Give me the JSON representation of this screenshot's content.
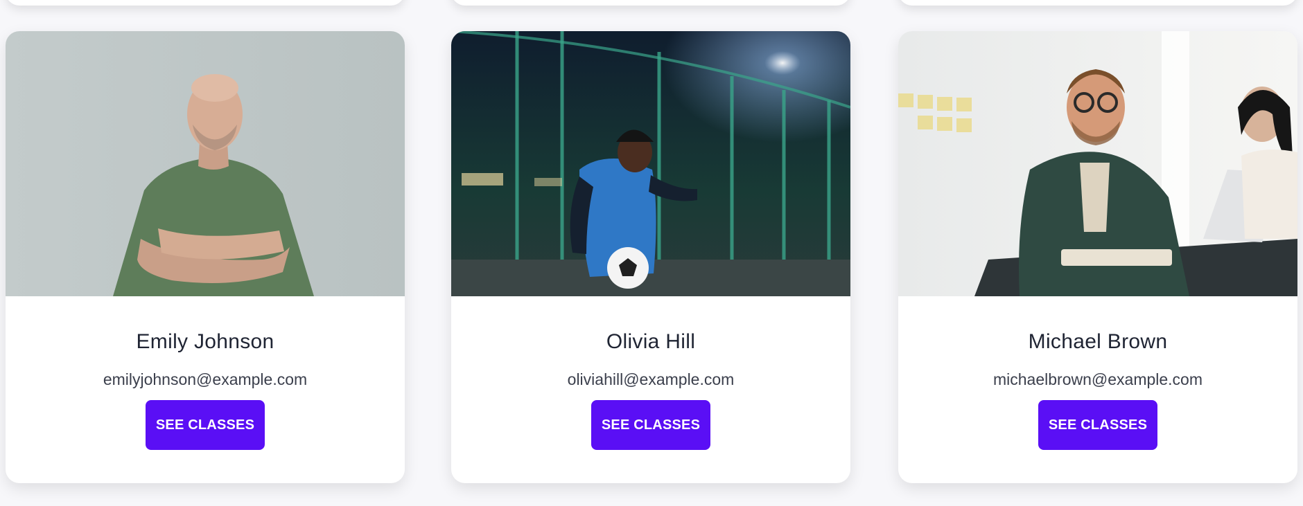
{
  "cards": [
    {
      "name": "Emily Johnson",
      "email": "emilyjohnson@example.com",
      "button_label": "SEE CLASSES"
    },
    {
      "name": "Olivia Hill",
      "email": "oliviahill@example.com",
      "button_label": "SEE CLASSES"
    },
    {
      "name": "Michael Brown",
      "email": "michaelbrown@example.com",
      "button_label": "SEE CLASSES"
    }
  ],
  "colors": {
    "accent": "#5a0ff5",
    "page_background": "#f7f7fa",
    "card_background": "#ffffff",
    "name_text": "#1f2433",
    "email_text": "#3b3f4c"
  }
}
